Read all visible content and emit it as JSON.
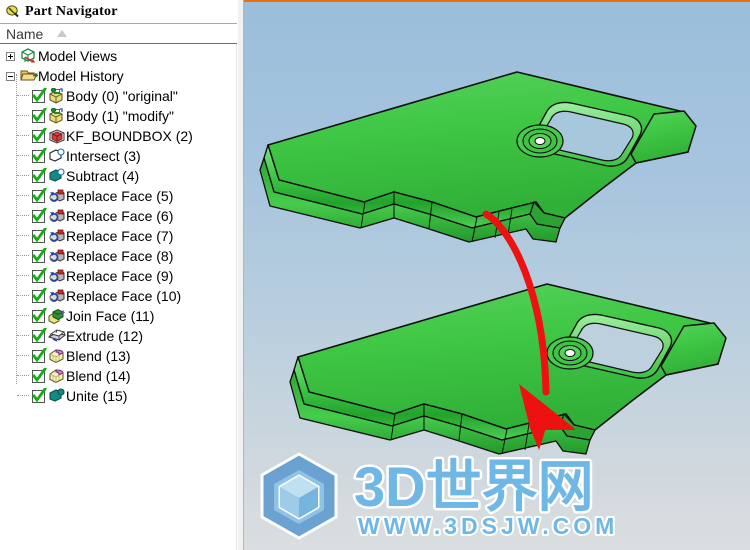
{
  "panel": {
    "title": "Part Navigator",
    "title_icon": "part-navigator-icon",
    "column_header": "Name",
    "sort_indicator": "sort-ascending-triangle"
  },
  "tree": [
    {
      "label": "Model Views",
      "level": 0,
      "expander": "plus",
      "checkbox": false,
      "icon": "model-views-icon"
    },
    {
      "label": "Model History",
      "level": 0,
      "expander": "minus",
      "checkbox": false,
      "icon": "folder-open-icon"
    },
    {
      "label": "Body (0) \"original\"",
      "level": 1,
      "expander": "none",
      "checkbox": true,
      "icon": "body-icon"
    },
    {
      "label": "Body (1) \"modify\"",
      "level": 1,
      "expander": "none",
      "checkbox": true,
      "icon": "body-icon"
    },
    {
      "label": "KF_BOUNDBOX (2)",
      "level": 1,
      "expander": "none",
      "checkbox": true,
      "icon": "boundbox-icon"
    },
    {
      "label": "Intersect (3)",
      "level": 1,
      "expander": "none",
      "checkbox": true,
      "icon": "intersect-icon"
    },
    {
      "label": "Subtract (4)",
      "level": 1,
      "expander": "none",
      "checkbox": true,
      "icon": "subtract-icon"
    },
    {
      "label": "Replace Face (5)",
      "level": 1,
      "expander": "none",
      "checkbox": true,
      "icon": "replace-face-icon"
    },
    {
      "label": "Replace Face (6)",
      "level": 1,
      "expander": "none",
      "checkbox": true,
      "icon": "replace-face-icon"
    },
    {
      "label": "Replace Face (7)",
      "level": 1,
      "expander": "none",
      "checkbox": true,
      "icon": "replace-face-icon"
    },
    {
      "label": "Replace Face (8)",
      "level": 1,
      "expander": "none",
      "checkbox": true,
      "icon": "replace-face-icon"
    },
    {
      "label": "Replace Face (9)",
      "level": 1,
      "expander": "none",
      "checkbox": true,
      "icon": "replace-face-icon"
    },
    {
      "label": "Replace Face (10)",
      "level": 1,
      "expander": "none",
      "checkbox": true,
      "icon": "replace-face-icon"
    },
    {
      "label": "Join Face (11)",
      "level": 1,
      "expander": "none",
      "checkbox": true,
      "icon": "join-face-icon"
    },
    {
      "label": "Extrude (12)",
      "level": 1,
      "expander": "none",
      "checkbox": true,
      "icon": "extrude-icon"
    },
    {
      "label": "Blend (13)",
      "level": 1,
      "expander": "none",
      "checkbox": true,
      "icon": "blend-icon"
    },
    {
      "label": "Blend (14)",
      "level": 1,
      "expander": "none",
      "checkbox": true,
      "icon": "blend-icon"
    },
    {
      "label": "Unite (15)",
      "level": 1,
      "expander": "none",
      "checkbox": true,
      "icon": "unite-icon"
    }
  ],
  "viewport": {
    "name": "graphics-window",
    "background_top": "#9bbedb",
    "background_bottom": "#dadee1",
    "focus_border_color": "#e8700f",
    "model_color": "#3fcc46",
    "annotation_arrow_color": "#ee1111",
    "objects": [
      {
        "name": "sheet-metal-part-original"
      },
      {
        "name": "sheet-metal-part-modify"
      },
      {
        "name": "transition-arrow"
      }
    ]
  },
  "watermark": {
    "brand": "3D世界网",
    "url": "WWW.3DSJW.COM",
    "logo": "hexagon-cube-logo",
    "color": "#59a8dd"
  }
}
